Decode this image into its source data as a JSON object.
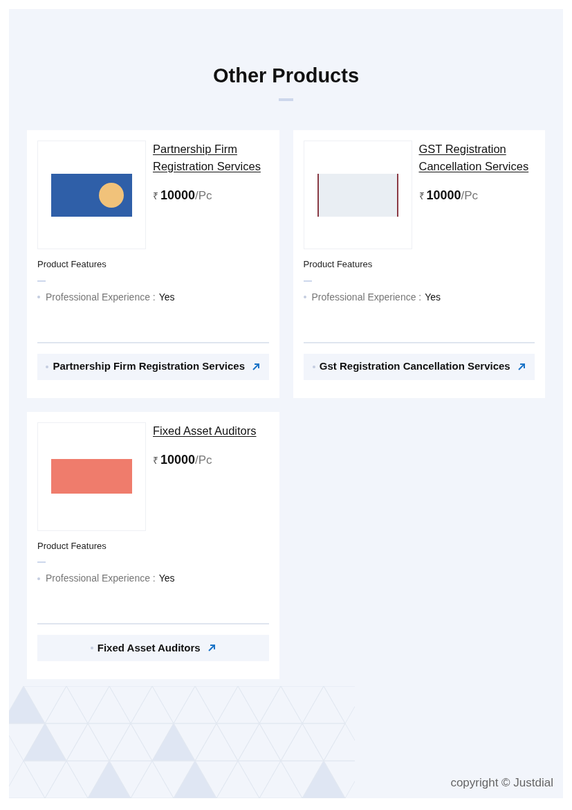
{
  "heading": "Other Products",
  "products": [
    {
      "title": "Partnership Firm Registration Services",
      "currency": "₹",
      "price": "10000",
      "unit": "/Pc",
      "features_title": "Product Features",
      "features": [
        {
          "label": "Professional Experience :",
          "value": "Yes"
        }
      ],
      "link": "Partnership Firm Registration Services"
    },
    {
      "title": "GST Registration Cancellation Services",
      "currency": "₹",
      "price": "10000",
      "unit": "/Pc",
      "features_title": "Product Features",
      "features": [
        {
          "label": "Professional Experience :",
          "value": "Yes"
        }
      ],
      "link": "Gst Registration Cancellation Services"
    },
    {
      "title": "Fixed Asset Auditors",
      "currency": "₹",
      "price": "10000",
      "unit": "/Pc",
      "features_title": "Product Features",
      "features": [
        {
          "label": "Professional Experience :",
          "value": "Yes"
        }
      ],
      "link": "Fixed Asset Auditors"
    }
  ],
  "copyright": "copyright © Justdial"
}
